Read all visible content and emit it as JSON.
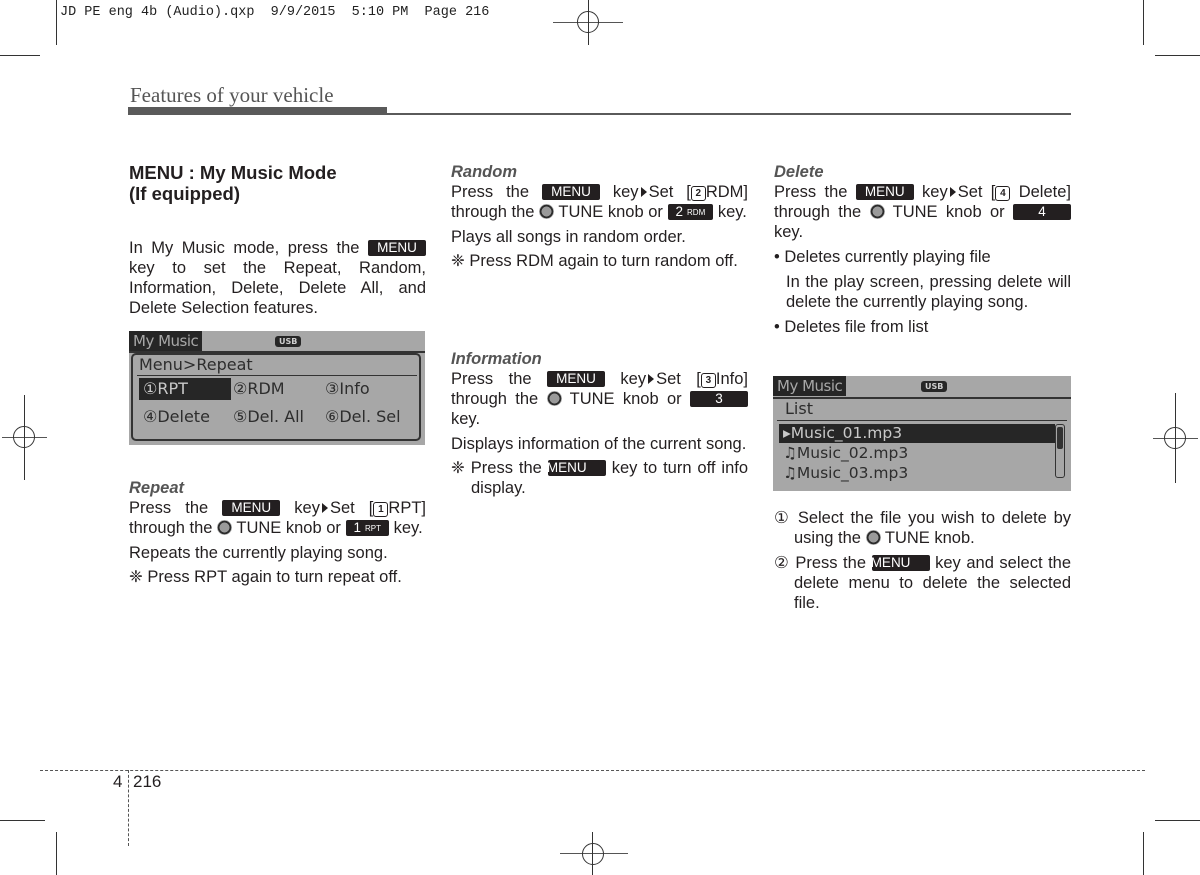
{
  "slug": "JD PE eng 4b (Audio).qxp  9/9/2015  5:10 PM  Page 216",
  "header": {
    "title": "Features of your vehicle"
  },
  "keys": {
    "menu": "MENU",
    "key1": "1",
    "key1_sub": "RPT",
    "key2": "2",
    "key2_sub": "RDM",
    "key3": "3",
    "key4": "4"
  },
  "icons": {
    "knob": "tune-knob-icon",
    "arrow": "right-triangle-icon",
    "note": "❈"
  },
  "col1": {
    "title_line1": "MENU : My Music Mode",
    "title_line2": "(If equipped)",
    "intro_a": "In My Music mode, press the",
    "intro_b": "key to set the Repeat, Random, Information, Delete, Delete All, and Delete Selection features.",
    "screen": {
      "tab": "My Music",
      "source": "USB",
      "breadcrumb": "Menu>Repeat",
      "options": [
        {
          "num": "①",
          "label": "RPT",
          "selected": true
        },
        {
          "num": "②",
          "label": "RDM",
          "selected": false
        },
        {
          "num": "③",
          "label": "Info",
          "selected": false
        },
        {
          "num": "④",
          "label": "Delete",
          "selected": false
        },
        {
          "num": "⑤",
          "label": "Del. All",
          "selected": false
        },
        {
          "num": "⑥",
          "label": "Del. Sel",
          "selected": false
        }
      ]
    },
    "repeat": {
      "heading": "Repeat",
      "press": "Press the",
      "key_set": "key",
      "set": "Set [",
      "set_num": "1",
      "set_label": "RPT]",
      "through": "through the",
      "tune_or": "TUNE knob or",
      "key_end": "key.",
      "desc": "Repeats the currently playing song.",
      "note": "Press RPT again to turn repeat off."
    }
  },
  "col2": {
    "random": {
      "heading": "Random",
      "press": "Press the",
      "key_set": "key",
      "set": "Set [",
      "set_num": "2",
      "set_label": "RDM]",
      "through": "through the",
      "tune_or": "TUNE knob or",
      "key_end": "key.",
      "desc": "Plays all songs in random order.",
      "note": "Press RDM again to turn random off."
    },
    "information": {
      "heading": "Information",
      "press": "Press the",
      "key_set": "key",
      "set": "Set [",
      "set_num": "3",
      "set_label": "Info]",
      "through": "through the",
      "tune_or": "TUNE knob or",
      "key_end": "key.",
      "desc": "Displays information of the current song.",
      "note_a": "Press the",
      "note_b": "key to turn off info display."
    }
  },
  "col3": {
    "delete": {
      "heading": "Delete",
      "press": "Press the",
      "key_set": "key",
      "set": "Set [",
      "set_num": "4",
      "set_label": "Delete] through the",
      "tune_or": "TUNE knob or",
      "key_end": "key.",
      "bullet1": "• Deletes currently playing file",
      "bullet1_desc": "In the play screen, pressing delete will delete the currently playing song.",
      "bullet2": "• Deletes file from list",
      "screen": {
        "tab": "My Music",
        "source": "USB",
        "breadcrumb": "List",
        "files": [
          {
            "icon": "▸",
            "name": "Music_01.mp3",
            "selected": true
          },
          {
            "icon": "♫",
            "name": "Music_02.mp3",
            "selected": false
          },
          {
            "icon": "♫",
            "name": "Music_03.mp3",
            "selected": false
          }
        ]
      },
      "step1_num": "①",
      "step1_a": "Select the file you wish to delete by using the",
      "step1_b": "TUNE knob.",
      "step2_num": "②",
      "step2_a": "Press the",
      "step2_b": "key and select the delete menu to delete the selected file."
    }
  },
  "footer": {
    "section": "4",
    "page": "216"
  }
}
